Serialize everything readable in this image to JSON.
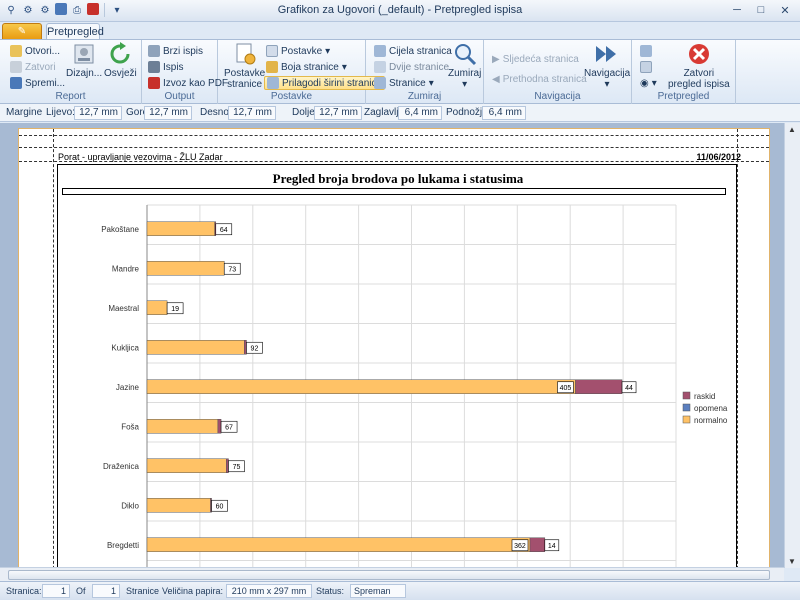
{
  "window": {
    "title": "Grafikon za Ugovori (_default) - Pretpregled ispisa"
  },
  "tabs": {
    "app_menu": "",
    "active": "Pretpregled"
  },
  "ribbon": {
    "report": {
      "label": "Report",
      "open": "Otvori...",
      "close": "Zatvori",
      "save": "Spremi...",
      "design": "Dizajn...",
      "refresh": "Osvježi"
    },
    "output": {
      "label": "Output",
      "quick_print": "Brzi ispis",
      "print": "Ispis",
      "export_pdf": "Izvoz kao PDF"
    },
    "settings": {
      "label": "Postavke",
      "page_setup": "Postavke stranice",
      "page_setup_l1": "Postavke",
      "page_setup_l2": "stranice",
      "setup_dd": "Postavke",
      "page_color": "Boja stranice",
      "fit_width": "Prilagodi širini stranice"
    },
    "zoom": {
      "label": "Zumiraj",
      "whole_page": "Cijela stranica",
      "two_pages": "Dvije stranice",
      "pages": "Stranice",
      "zoom": "Zumiraj"
    },
    "navigation": {
      "label": "Navigacija",
      "next": "Sljedeća stranica",
      "prev": "Prethodna stranica",
      "nav": "Navigacija"
    },
    "preview": {
      "label": "Pretpregled",
      "close_l1": "Zatvori",
      "close_l2": "pregled ispisa"
    }
  },
  "margins": {
    "label": "Margine",
    "left_label": "Lijevo:",
    "left": "12,7 mm",
    "top_label": "Gore:",
    "top": "12,7 mm",
    "right_label": "Desno:",
    "right": "12,7 mm",
    "bottom_label": "Dolje:",
    "bottom": "12,7 mm",
    "header_label": "Zaglavlje:",
    "header": "6,4 mm",
    "footer_label": "Podnožje:",
    "footer": "6,4 mm"
  },
  "report": {
    "header": "Porat - upravljanje vezovima - ŽLU Zadar",
    "date": "11/06/2012"
  },
  "chart_data": {
    "type": "bar",
    "orientation": "horizontal",
    "stacked": true,
    "title": "Pregled broja brodova po lukama i statusima",
    "categories": [
      "Pakoštane",
      "Mandre",
      "Maestral",
      "Kukljica",
      "Jazine",
      "Foša",
      "Draženica",
      "Diklo",
      "Bregdetti"
    ],
    "series": [
      {
        "name": "normalno",
        "color": "#ffc266",
        "values": [
          64,
          73,
          19,
          92,
          405,
          67,
          75,
          60,
          362
        ]
      },
      {
        "name": "opomena",
        "color": "#5b7fbf",
        "values": [
          0,
          0,
          0,
          0,
          0,
          0,
          0,
          0,
          0
        ]
      },
      {
        "name": "raskid",
        "color": "#a3506e",
        "values": [
          1,
          0,
          0,
          2,
          44,
          3,
          2,
          1,
          14
        ]
      }
    ],
    "point_labels": [
      {
        "normalno": "64"
      },
      {
        "normalno": "73"
      },
      {
        "normalno": "19"
      },
      {
        "normalno": "92"
      },
      {
        "normalno": "405",
        "raskid": "44"
      },
      {
        "normalno": "67"
      },
      {
        "normalno": "75"
      },
      {
        "normalno": "60"
      },
      {
        "normalno": "362",
        "raskid": "14"
      }
    ],
    "legend_order": [
      "raskid",
      "opomena",
      "normalno"
    ],
    "legend_position": "right",
    "xlim": [
      0,
      500
    ],
    "grid": true
  },
  "status": {
    "page_label": "Stranica:",
    "page": "1",
    "of_label": "Of",
    "of": "1",
    "pages_label": "Stranice",
    "paper_label": "Veličina papira:",
    "paper": "210 mm x 297 mm",
    "status_label": "Status:",
    "status": "Spreman"
  }
}
